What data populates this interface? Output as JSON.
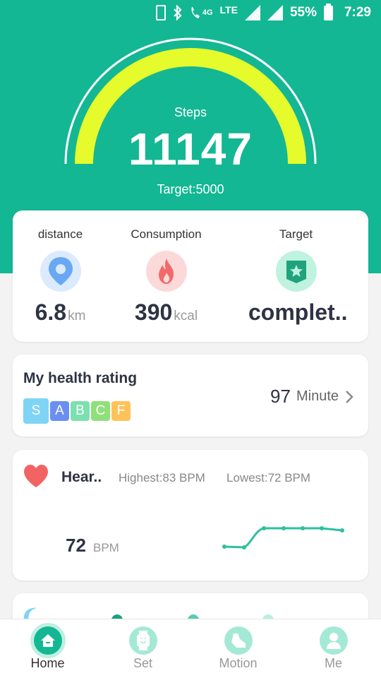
{
  "status_bar": {
    "battery": "55%",
    "time": "7:29",
    "network": "LTE",
    "signal_tag": "4G"
  },
  "steps": {
    "label": "Steps",
    "value": "11147",
    "target": "Target:5000",
    "progress": 1.0
  },
  "summary": {
    "distance": {
      "title": "distance",
      "value": "6.8",
      "unit": "km",
      "icon": "location-pin-icon"
    },
    "consumption": {
      "title": "Consumption",
      "value": "390",
      "unit": "kcal",
      "icon": "flame-icon"
    },
    "target": {
      "title": "Target",
      "value": "complet..",
      "icon": "star-badge-icon"
    }
  },
  "health_rating": {
    "title": "My health rating",
    "grades": [
      "S",
      "A",
      "B",
      "C",
      "F"
    ],
    "grade_colors": [
      "#7fd4f5",
      "#6b8ff0",
      "#7de0b0",
      "#8fe07a",
      "#ffc25a"
    ],
    "value": "97",
    "unit": "Minute"
  },
  "heart_rate": {
    "title": "Hear..",
    "highest": "Highest:83  BPM",
    "lowest": "Lowest:72  BPM",
    "value": "72",
    "unit": "BPM"
  },
  "nav": [
    {
      "label": "Home",
      "icon": "home-icon",
      "active": true
    },
    {
      "label": "Set",
      "icon": "watch-icon",
      "active": false
    },
    {
      "label": "Motion",
      "icon": "shoe-icon",
      "active": false
    },
    {
      "label": "Me",
      "icon": "person-icon",
      "active": false
    }
  ],
  "colors": {
    "primary": "#13b793",
    "gauge": "#e5fb2b",
    "text_dark": "#2e3344"
  }
}
